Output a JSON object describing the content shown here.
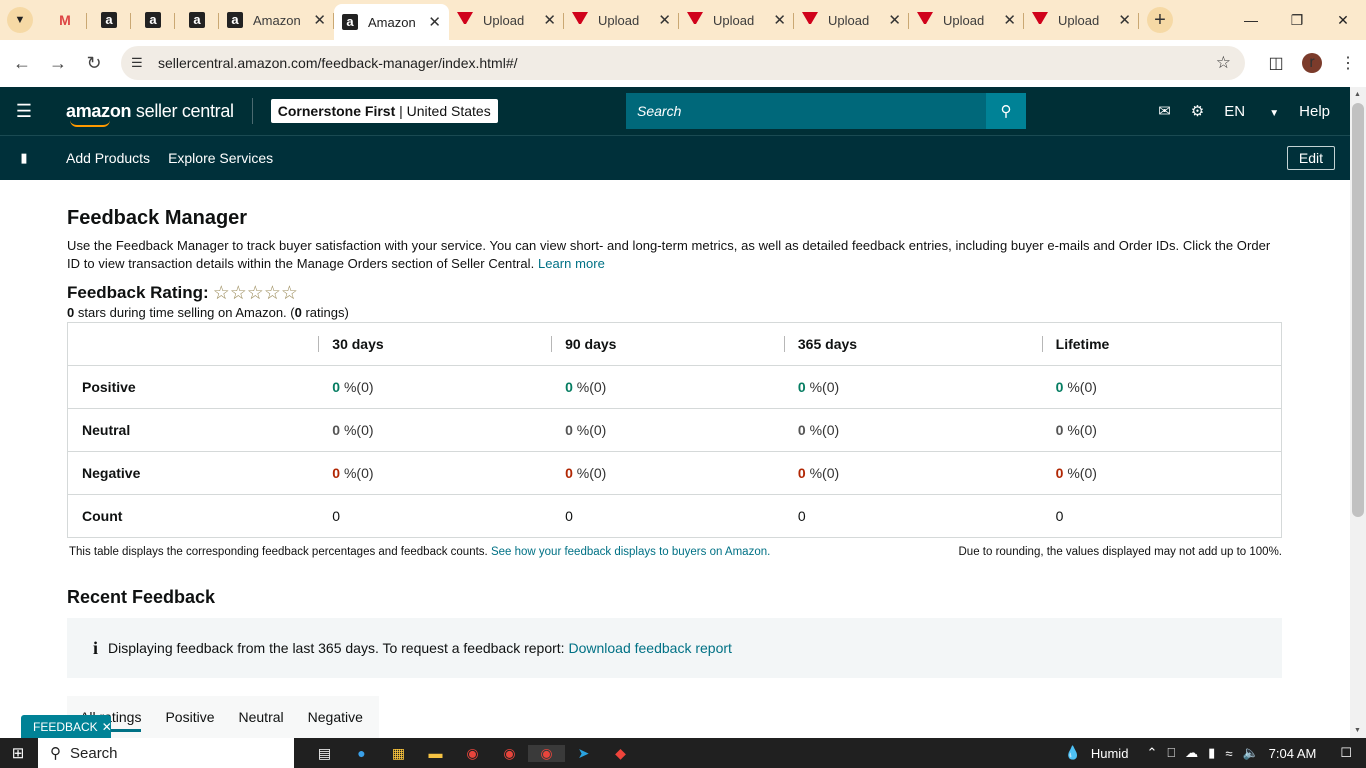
{
  "browser": {
    "tabs": [
      {
        "title": "",
        "favicon": "gmail-icon",
        "active": false
      },
      {
        "title": "",
        "favicon": "amazon-icon",
        "active": false
      },
      {
        "title": "",
        "favicon": "amazon-icon",
        "active": false
      },
      {
        "title": "",
        "favicon": "amazon-icon",
        "active": false
      },
      {
        "title": "Amazon",
        "favicon": "amazon-icon",
        "active": false
      },
      {
        "title": "Amazon",
        "favicon": "amazon-icon",
        "active": true
      },
      {
        "title": "Upload",
        "favicon": "vee-icon",
        "active": false
      },
      {
        "title": "Upload",
        "favicon": "vee-icon",
        "active": false
      },
      {
        "title": "Upload",
        "favicon": "vee-icon",
        "active": false
      },
      {
        "title": "Upload",
        "favicon": "vee-icon",
        "active": false
      },
      {
        "title": "Upload",
        "favicon": "vee-icon",
        "active": false
      },
      {
        "title": "Upload",
        "favicon": "vee-icon",
        "active": false
      }
    ],
    "url": "sellercentral.amazon.com/feedback-manager/index.html#/",
    "profile_initial": "r"
  },
  "header": {
    "logo_bold": "amazon",
    "logo_rest": " seller central",
    "store_name": "Cornerstone First",
    "store_sep": " | ",
    "store_region": "United States",
    "search_placeholder": "Search",
    "language": "EN",
    "help": "Help"
  },
  "subnav": {
    "links": [
      "Add Products",
      "Explore Services"
    ],
    "edit": "Edit"
  },
  "page": {
    "title": "Feedback Manager",
    "intro": "Use the Feedback Manager to track buyer satisfaction with your service. You can view short- and long-term metrics, as well as detailed feedback entries, including buyer e-mails and Order IDs. Click the Order ID to view transaction details within the Manage Orders section of Seller Central.",
    "learn_more": "Learn more",
    "rating_label": "Feedback Rating:",
    "rating_stars": 0,
    "rating_stars_max": 5,
    "rating_sub_stars": "0",
    "rating_sub_mid": " stars during time selling on Amazon. (",
    "rating_sub_count": "0",
    "rating_sub_end": " ratings)"
  },
  "table": {
    "columns": [
      "30 days",
      "90 days",
      "365 days",
      "Lifetime"
    ],
    "rows": [
      {
        "label": "Positive",
        "kind": "positive",
        "cells": [
          {
            "v": "0",
            "p": " %(0)"
          },
          {
            "v": "0",
            "p": " %(0)"
          },
          {
            "v": "0",
            "p": " %(0)"
          },
          {
            "v": "0",
            "p": " %(0)"
          }
        ]
      },
      {
        "label": "Neutral",
        "kind": "neutral",
        "cells": [
          {
            "v": "0",
            "p": " %(0)"
          },
          {
            "v": "0",
            "p": " %(0)"
          },
          {
            "v": "0",
            "p": " %(0)"
          },
          {
            "v": "0",
            "p": " %(0)"
          }
        ]
      },
      {
        "label": "Negative",
        "kind": "negative",
        "cells": [
          {
            "v": "0",
            "p": " %(0)"
          },
          {
            "v": "0",
            "p": " %(0)"
          },
          {
            "v": "0",
            "p": " %(0)"
          },
          {
            "v": "0",
            "p": " %(0)"
          }
        ]
      },
      {
        "label": "Count",
        "kind": "count",
        "cells": [
          {
            "v": "0",
            "p": ""
          },
          {
            "v": "0",
            "p": ""
          },
          {
            "v": "0",
            "p": ""
          },
          {
            "v": "0",
            "p": ""
          }
        ]
      }
    ],
    "note_left": "This table displays the corresponding feedback percentages and feedback counts.",
    "note_link": "See how your feedback displays to buyers on Amazon.",
    "note_right": "Due to rounding, the values displayed may not add up to 100%."
  },
  "recent": {
    "title": "Recent Feedback",
    "info": "Displaying feedback from the last 365 days. To request a feedback report:",
    "info_link": "Download feedback report",
    "filters": [
      "All ratings",
      "Positive",
      "Neutral",
      "Negative"
    ]
  },
  "feedback_tab": "FEEDBACK",
  "taskbar": {
    "search": "Search",
    "weather": "Humid",
    "time": "7:04 AM"
  },
  "colors": {
    "header_bg": "#002f36",
    "search_bg": "#00687a",
    "link": "#007185",
    "positive": "#067d62",
    "negative": "#b12704"
  }
}
